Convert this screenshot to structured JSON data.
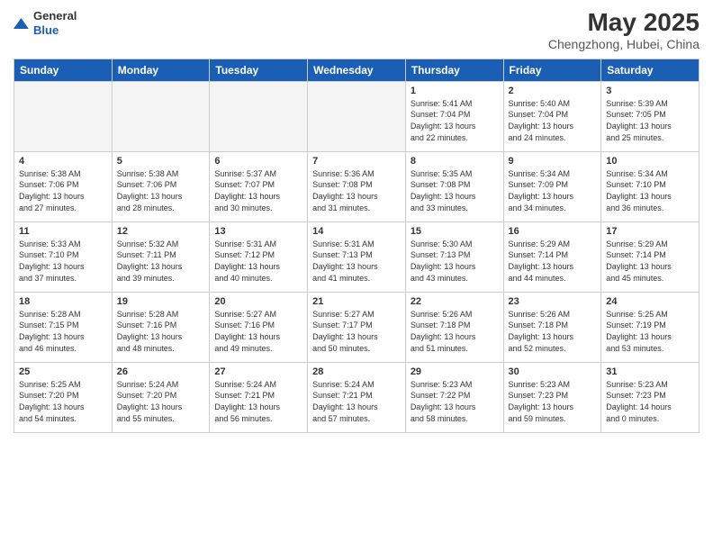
{
  "header": {
    "logo_general": "General",
    "logo_blue": "Blue",
    "month_year": "May 2025",
    "location": "Chengzhong, Hubei, China"
  },
  "days_of_week": [
    "Sunday",
    "Monday",
    "Tuesday",
    "Wednesday",
    "Thursday",
    "Friday",
    "Saturday"
  ],
  "weeks": [
    [
      {
        "day": "",
        "text": ""
      },
      {
        "day": "",
        "text": ""
      },
      {
        "day": "",
        "text": ""
      },
      {
        "day": "",
        "text": ""
      },
      {
        "day": "1",
        "text": "Sunrise: 5:41 AM\nSunset: 7:04 PM\nDaylight: 13 hours\nand 22 minutes."
      },
      {
        "day": "2",
        "text": "Sunrise: 5:40 AM\nSunset: 7:04 PM\nDaylight: 13 hours\nand 24 minutes."
      },
      {
        "day": "3",
        "text": "Sunrise: 5:39 AM\nSunset: 7:05 PM\nDaylight: 13 hours\nand 25 minutes."
      }
    ],
    [
      {
        "day": "4",
        "text": "Sunrise: 5:38 AM\nSunset: 7:06 PM\nDaylight: 13 hours\nand 27 minutes."
      },
      {
        "day": "5",
        "text": "Sunrise: 5:38 AM\nSunset: 7:06 PM\nDaylight: 13 hours\nand 28 minutes."
      },
      {
        "day": "6",
        "text": "Sunrise: 5:37 AM\nSunset: 7:07 PM\nDaylight: 13 hours\nand 30 minutes."
      },
      {
        "day": "7",
        "text": "Sunrise: 5:36 AM\nSunset: 7:08 PM\nDaylight: 13 hours\nand 31 minutes."
      },
      {
        "day": "8",
        "text": "Sunrise: 5:35 AM\nSunset: 7:08 PM\nDaylight: 13 hours\nand 33 minutes."
      },
      {
        "day": "9",
        "text": "Sunrise: 5:34 AM\nSunset: 7:09 PM\nDaylight: 13 hours\nand 34 minutes."
      },
      {
        "day": "10",
        "text": "Sunrise: 5:34 AM\nSunset: 7:10 PM\nDaylight: 13 hours\nand 36 minutes."
      }
    ],
    [
      {
        "day": "11",
        "text": "Sunrise: 5:33 AM\nSunset: 7:10 PM\nDaylight: 13 hours\nand 37 minutes."
      },
      {
        "day": "12",
        "text": "Sunrise: 5:32 AM\nSunset: 7:11 PM\nDaylight: 13 hours\nand 39 minutes."
      },
      {
        "day": "13",
        "text": "Sunrise: 5:31 AM\nSunset: 7:12 PM\nDaylight: 13 hours\nand 40 minutes."
      },
      {
        "day": "14",
        "text": "Sunrise: 5:31 AM\nSunset: 7:13 PM\nDaylight: 13 hours\nand 41 minutes."
      },
      {
        "day": "15",
        "text": "Sunrise: 5:30 AM\nSunset: 7:13 PM\nDaylight: 13 hours\nand 43 minutes."
      },
      {
        "day": "16",
        "text": "Sunrise: 5:29 AM\nSunset: 7:14 PM\nDaylight: 13 hours\nand 44 minutes."
      },
      {
        "day": "17",
        "text": "Sunrise: 5:29 AM\nSunset: 7:14 PM\nDaylight: 13 hours\nand 45 minutes."
      }
    ],
    [
      {
        "day": "18",
        "text": "Sunrise: 5:28 AM\nSunset: 7:15 PM\nDaylight: 13 hours\nand 46 minutes."
      },
      {
        "day": "19",
        "text": "Sunrise: 5:28 AM\nSunset: 7:16 PM\nDaylight: 13 hours\nand 48 minutes."
      },
      {
        "day": "20",
        "text": "Sunrise: 5:27 AM\nSunset: 7:16 PM\nDaylight: 13 hours\nand 49 minutes."
      },
      {
        "day": "21",
        "text": "Sunrise: 5:27 AM\nSunset: 7:17 PM\nDaylight: 13 hours\nand 50 minutes."
      },
      {
        "day": "22",
        "text": "Sunrise: 5:26 AM\nSunset: 7:18 PM\nDaylight: 13 hours\nand 51 minutes."
      },
      {
        "day": "23",
        "text": "Sunrise: 5:26 AM\nSunset: 7:18 PM\nDaylight: 13 hours\nand 52 minutes."
      },
      {
        "day": "24",
        "text": "Sunrise: 5:25 AM\nSunset: 7:19 PM\nDaylight: 13 hours\nand 53 minutes."
      }
    ],
    [
      {
        "day": "25",
        "text": "Sunrise: 5:25 AM\nSunset: 7:20 PM\nDaylight: 13 hours\nand 54 minutes."
      },
      {
        "day": "26",
        "text": "Sunrise: 5:24 AM\nSunset: 7:20 PM\nDaylight: 13 hours\nand 55 minutes."
      },
      {
        "day": "27",
        "text": "Sunrise: 5:24 AM\nSunset: 7:21 PM\nDaylight: 13 hours\nand 56 minutes."
      },
      {
        "day": "28",
        "text": "Sunrise: 5:24 AM\nSunset: 7:21 PM\nDaylight: 13 hours\nand 57 minutes."
      },
      {
        "day": "29",
        "text": "Sunrise: 5:23 AM\nSunset: 7:22 PM\nDaylight: 13 hours\nand 58 minutes."
      },
      {
        "day": "30",
        "text": "Sunrise: 5:23 AM\nSunset: 7:23 PM\nDaylight: 13 hours\nand 59 minutes."
      },
      {
        "day": "31",
        "text": "Sunrise: 5:23 AM\nSunset: 7:23 PM\nDaylight: 14 hours\nand 0 minutes."
      }
    ]
  ]
}
